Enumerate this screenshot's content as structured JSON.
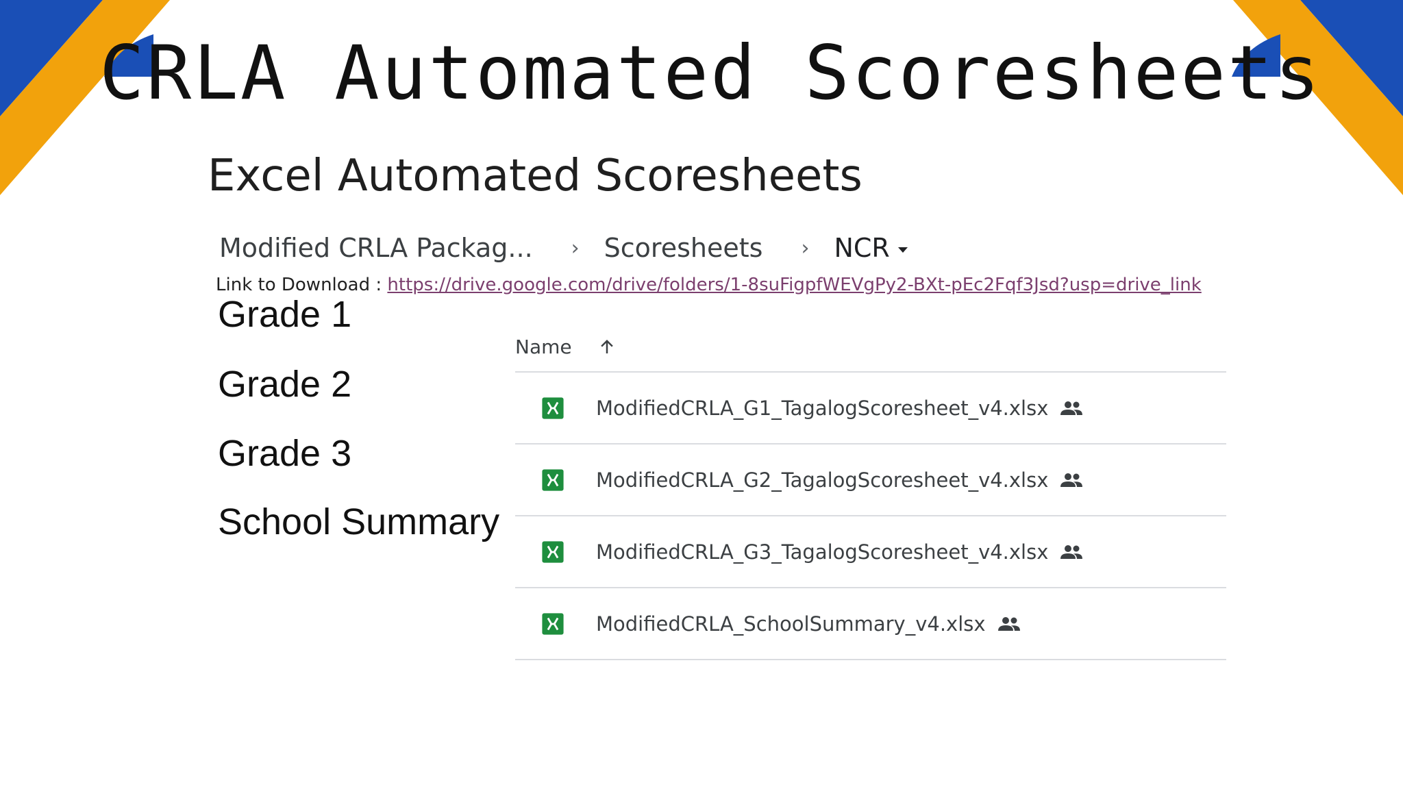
{
  "slide": {
    "title": "CRLA Automated Scoresheets"
  },
  "content": {
    "heading": "Excel Automated Scoresheets",
    "breadcrumb": [
      "Modified CRLA Packag...",
      "Scoresheets",
      "NCR"
    ],
    "download_label": "Link to Download : ",
    "download_url": "https://drive.google.com/drive/folders/1-8suFigpfWEVgPy2-BXt-pEc2Fqf3Jsd?usp=drive_link",
    "grade_labels": [
      "Grade 1",
      "Grade 2",
      "Grade 3",
      "School Summary"
    ]
  },
  "file_list": {
    "column_name": "Name",
    "sort_icon": "arrow-up-icon",
    "file_icon": "excel-file-icon",
    "shared_icon": "people-shared-icon",
    "files": [
      "ModifiedCRLA_G1_TagalogScoresheet_v4.xlsx",
      "ModifiedCRLA_G2_TagalogScoresheet_v4.xlsx",
      "ModifiedCRLA_G3_TagalogScoresheet_v4.xlsx",
      "ModifiedCRLA_SchoolSummary_v4.xlsx"
    ]
  },
  "colors": {
    "corner_blue": "#1a4fb6",
    "corner_gold": "#f2a20c",
    "excel_green": "#1e8e3e",
    "link_color": "#7b3f6e"
  }
}
